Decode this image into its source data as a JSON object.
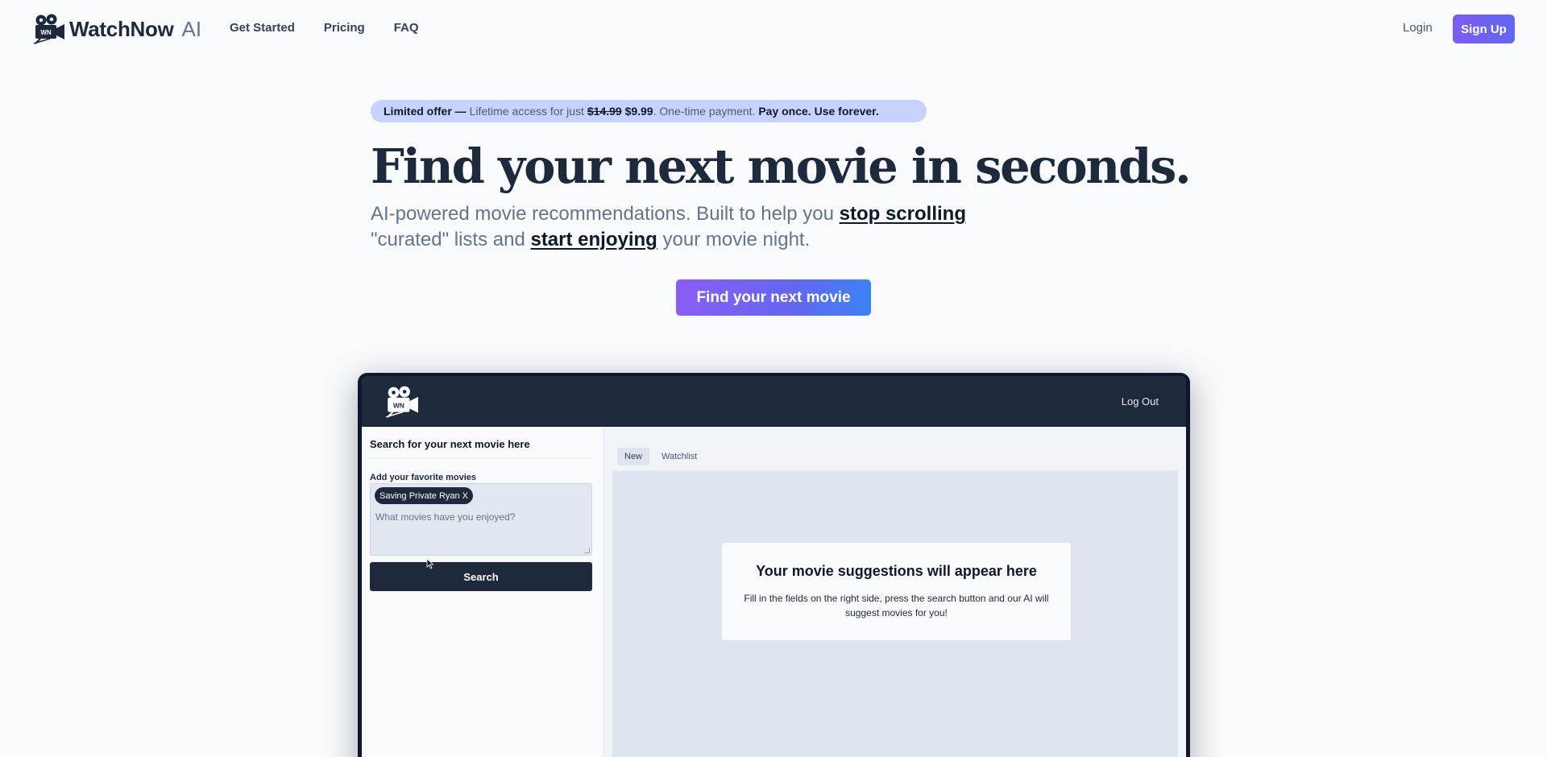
{
  "nav": {
    "brand_name": "WatchNow",
    "brand_suffix": "AI",
    "logo_badge": "WN",
    "links": [
      {
        "label": "Get Started"
      },
      {
        "label": "Pricing"
      },
      {
        "label": "FAQ"
      }
    ],
    "login_label": "Login",
    "signup_label": "Sign Up"
  },
  "offer": {
    "tag": "Limited offer",
    "dash": "—",
    "text": "Lifetime access for just",
    "old_price": "$14.99",
    "new_price": "$9.99",
    "payment": ". One-time payment.",
    "emphasis": "Pay once. Use forever."
  },
  "hero": {
    "headline": "Find your next movie in seconds.",
    "sub_line1_a": "AI-powered movie recommendations. Built to help you ",
    "sub_line1_link": "stop scrolling",
    "sub_line2_a": "\"curated\" lists and ",
    "sub_line2_link": "start enjoying",
    "sub_line2_b": " your movie night.",
    "cta_label": "Find your next movie"
  },
  "app": {
    "logo_badge": "WN",
    "logout_label": "Log Out",
    "panel_title": "Search for your next movie here",
    "field_label": "Add your favorite movies",
    "chips": [
      {
        "label": "Saving Private Ryan",
        "remove": "X"
      }
    ],
    "input_placeholder": "What movies have you enjoyed?",
    "search_label": "Search",
    "tabs": [
      {
        "label": "New",
        "active": true
      },
      {
        "label": "Watchlist",
        "active": false
      }
    ],
    "empty_title": "Your movie suggestions will appear here",
    "empty_desc": "Fill in the fields on the right side, press the search button and our AI will suggest movies for you!"
  },
  "colors": {
    "accent_start": "#7c5cf3",
    "accent_end": "#3b82f6",
    "dark": "#1e293b",
    "offer_bg": "#c7d2fe"
  },
  "icons": {
    "brand": "movie-camera-icon",
    "cursor": "mouse-pointer-icon"
  }
}
